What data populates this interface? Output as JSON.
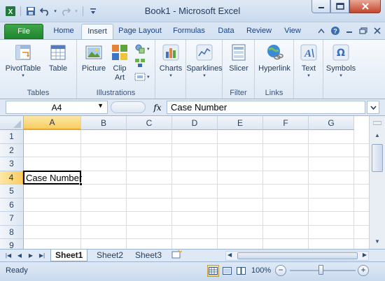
{
  "window": {
    "title": "Book1 - Microsoft Excel"
  },
  "qat": {
    "icons": [
      "excel-logo-icon",
      "save-icon",
      "undo-icon",
      "redo-icon",
      "customize-qat-icon"
    ]
  },
  "tabs": [
    {
      "label": "File",
      "state": "file"
    },
    {
      "label": "Home"
    },
    {
      "label": "Insert",
      "state": "active"
    },
    {
      "label": "Page Layout"
    },
    {
      "label": "Formulas"
    },
    {
      "label": "Data"
    },
    {
      "label": "Review"
    },
    {
      "label": "View"
    }
  ],
  "ribbon": {
    "groups": {
      "tables": "Tables",
      "illustrations": "Illustrations",
      "filter": "Filter",
      "links": "Links"
    },
    "buttons": {
      "pivottable": "PivotTable",
      "table": "Table",
      "picture": "Picture",
      "clipart": "Clip Art",
      "charts": "Charts",
      "sparklines": "Sparklines",
      "slicer": "Slicer",
      "hyperlink": "Hyperlink",
      "text": "Text",
      "symbols": "Symbols",
      "dropdown_marker": "▾"
    }
  },
  "formula_bar": {
    "name_box": "A4",
    "fx": "fx",
    "content": "Case Number"
  },
  "grid": {
    "columns": [
      "A",
      "B",
      "C",
      "D",
      "E",
      "F",
      "G"
    ],
    "rows": [
      "1",
      "2",
      "3",
      "4",
      "5",
      "6",
      "7",
      "8",
      "9"
    ],
    "active_cell": {
      "ref": "A4",
      "value": "Case Number"
    }
  },
  "sheets": [
    {
      "label": "Sheet1",
      "active": true
    },
    {
      "label": "Sheet2"
    },
    {
      "label": "Sheet3"
    }
  ],
  "status": {
    "ready": "Ready",
    "zoom": "100%",
    "zoom_out": "−",
    "zoom_in": "+"
  },
  "colors": {
    "file_tab": "#2f9a3c",
    "selection_header": "#f8cc62"
  }
}
